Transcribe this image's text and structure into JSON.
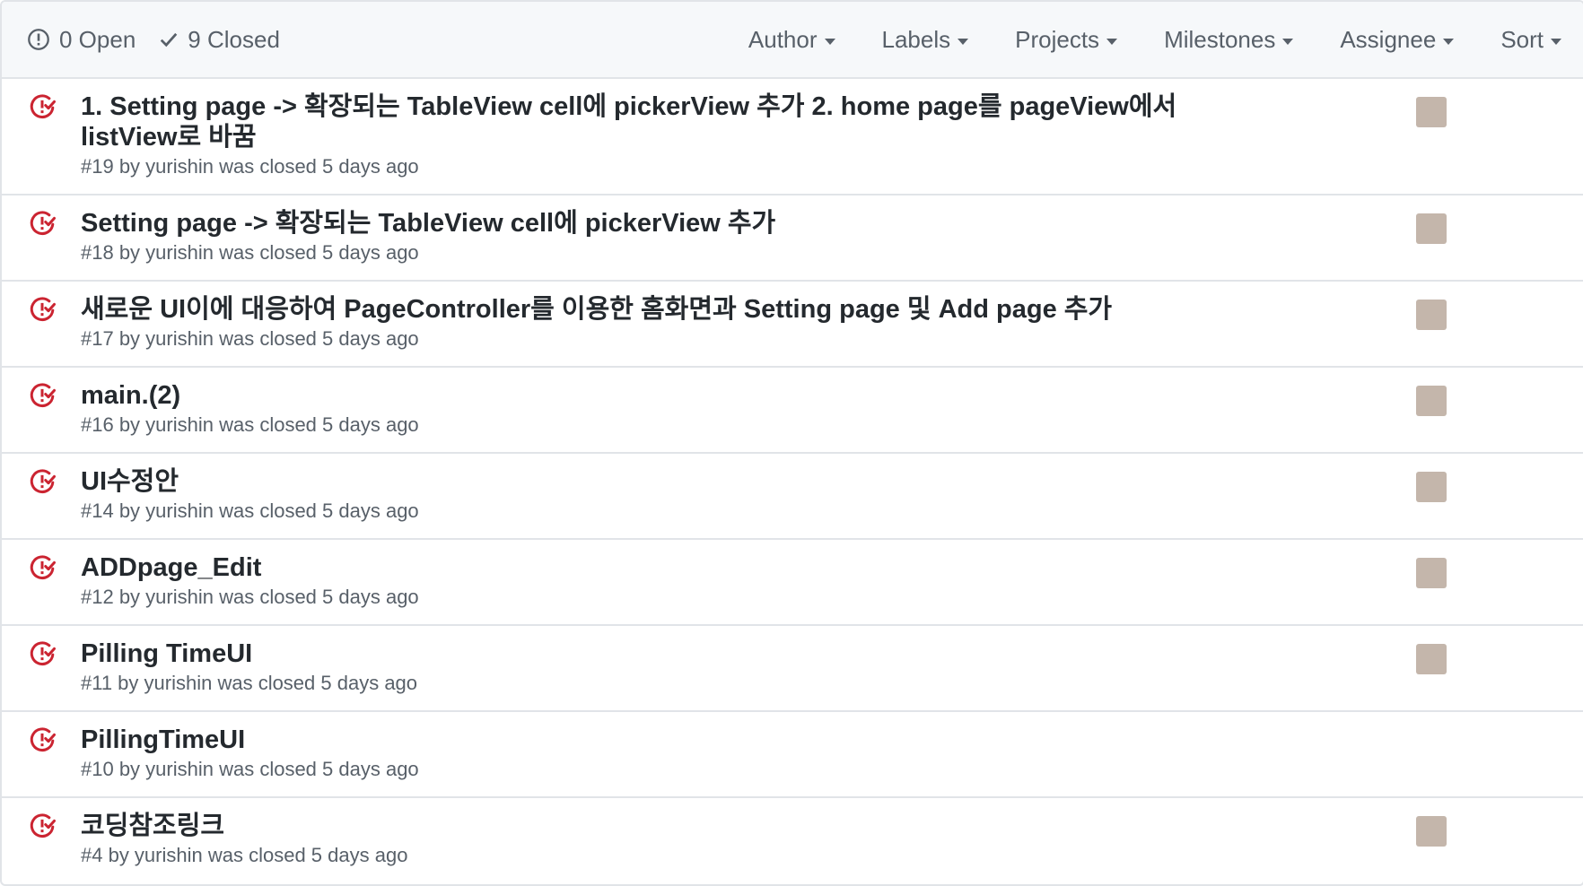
{
  "states": {
    "open_label": "0 Open",
    "closed_label": "9 Closed"
  },
  "filters": [
    "Author",
    "Labels",
    "Projects",
    "Milestones",
    "Assignee",
    "Sort"
  ],
  "colors": {
    "closed_icon": "#cb2431",
    "avatar": "#c4b6ab"
  },
  "issues": [
    {
      "title": "1. Setting page -> 확장되는 TableView cell에 pickerView 추가 2. home page를 pageView에서 listView로 바꿈",
      "meta": "#19 by yurishin was closed 5 days ago",
      "assignee": true
    },
    {
      "title": "Setting page -> 확장되는 TableView cell에 pickerView 추가",
      "meta": "#18 by yurishin was closed 5 days ago",
      "assignee": true
    },
    {
      "title": "새로운 UI이에 대응하여 PageController를 이용한 홈화면과 Setting page 및 Add page 추가",
      "meta": "#17 by yurishin was closed 5 days ago",
      "assignee": true
    },
    {
      "title": "main.(2)",
      "meta": "#16 by yurishin was closed 5 days ago",
      "assignee": true
    },
    {
      "title": "UI수정안",
      "meta": "#14 by yurishin was closed 5 days ago",
      "assignee": true
    },
    {
      "title": "ADDpage_Edit",
      "meta": "#12 by yurishin was closed 5 days ago",
      "assignee": true
    },
    {
      "title": "Pilling TimeUI",
      "meta": "#11 by yurishin was closed 5 days ago",
      "assignee": true
    },
    {
      "title": "PillingTimeUI",
      "meta": "#10 by yurishin was closed 5 days ago",
      "assignee": false
    },
    {
      "title": "코딩참조링크",
      "meta": "#4 by yurishin was closed 5 days ago",
      "assignee": true
    }
  ]
}
